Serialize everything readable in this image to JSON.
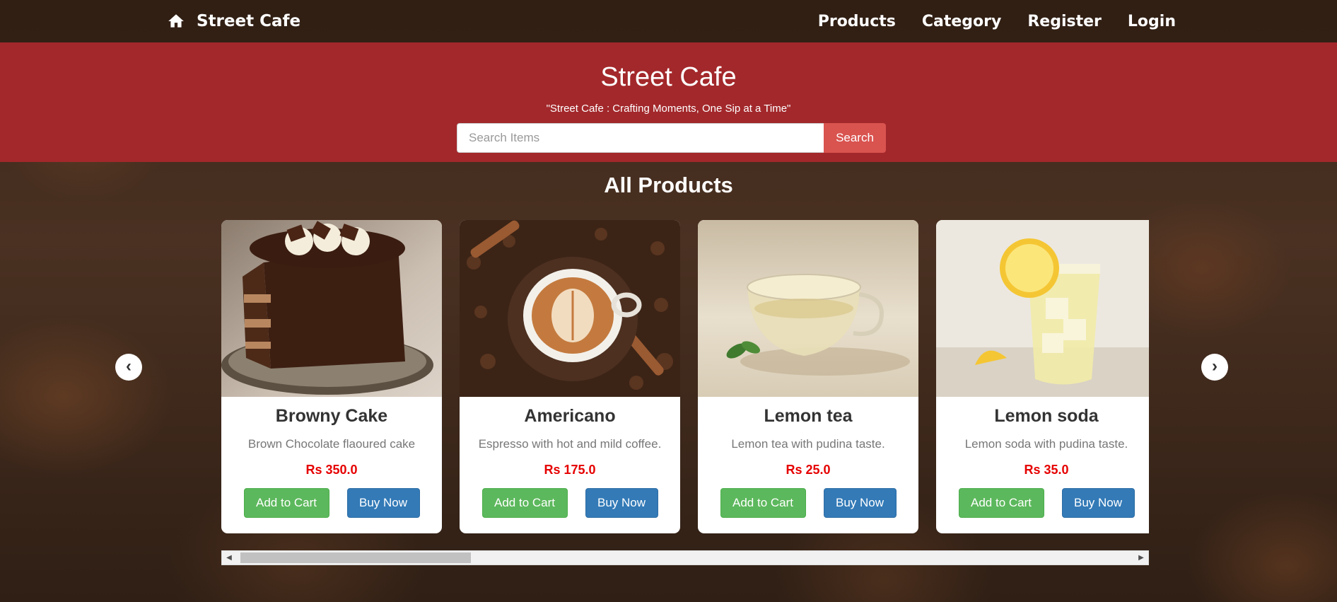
{
  "nav": {
    "brand": "Street Cafe",
    "home_icon": "home-icon",
    "links": [
      "Products",
      "Category",
      "Register",
      "Login"
    ]
  },
  "hero": {
    "title": "Street Cafe",
    "tagline": "\"Street Cafe : Crafting Moments, One Sip at a Time\"",
    "search_placeholder": "Search Items",
    "search_value": "",
    "search_button": "Search"
  },
  "section_title": "All Products",
  "carousel": {
    "prev_icon": "chevron-left-icon",
    "next_icon": "chevron-right-icon",
    "prev_glyph": "‹",
    "next_glyph": "›"
  },
  "products": [
    {
      "name": "Browny Cake",
      "description": "Brown Chocolate flaoured cake",
      "price": "Rs 350.0",
      "add_label": "Add to Cart",
      "buy_label": "Buy Now"
    },
    {
      "name": "Americano",
      "description": "Espresso with hot and mild coffee.",
      "price": "Rs 175.0",
      "add_label": "Add to Cart",
      "buy_label": "Buy Now"
    },
    {
      "name": "Lemon tea",
      "description": "Lemon tea with pudina taste.",
      "price": "Rs 25.0",
      "add_label": "Add to Cart",
      "buy_label": "Buy Now"
    },
    {
      "name": "Lemon soda",
      "description": "Lemon soda with pudina taste.",
      "price": "Rs 35.0",
      "add_label": "Add to Cart",
      "buy_label": "Buy Now"
    }
  ],
  "scrollbar": {
    "left_glyph": "◀",
    "right_glyph": "▶"
  },
  "colors": {
    "hero_bg": "#a3282b",
    "search_button": "#d9534f",
    "add_to_cart": "#5cb85c",
    "buy_now": "#337ab7",
    "price": "#e60000"
  }
}
